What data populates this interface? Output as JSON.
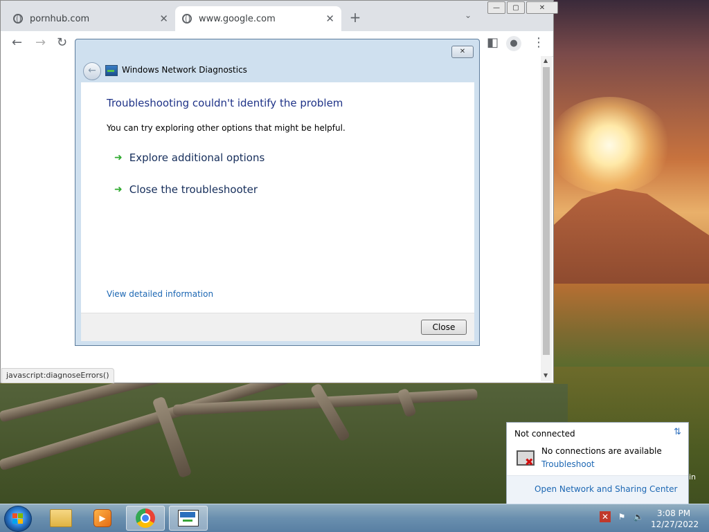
{
  "browser": {
    "tabs": [
      {
        "title": "pornhub.com",
        "close": "✕"
      },
      {
        "title": "www.google.com",
        "close": "✕"
      }
    ],
    "new_tab": "+",
    "tab_search": "⌄",
    "window_buttons": {
      "minimize": "—",
      "maximize": "▢",
      "close": "✕"
    },
    "status_url": "javascript:diagnoseErrors()"
  },
  "dialog": {
    "title": "Windows Network Diagnostics",
    "close": "✕",
    "heading": "Troubleshooting couldn't identify the problem",
    "subtext": "You can try exploring other options that might be helpful.",
    "options": [
      {
        "label": "Explore additional options"
      },
      {
        "label": "Close the troubleshooter"
      }
    ],
    "details_link": "View detailed information",
    "close_button": "Close"
  },
  "network_flyout": {
    "status": "Not connected",
    "message": "No connections are available",
    "troubleshoot_link": "Troubleshoot",
    "sharing_center_link": "Open Network and Sharing Center",
    "edge_text": "in"
  },
  "taskbar": {
    "clock_time": "3:08 PM",
    "clock_date": "12/27/2022"
  },
  "colors": {
    "dialog_heading": "#1e3287",
    "link": "#1c67b3",
    "option_arrow": "#2eaa2e"
  }
}
